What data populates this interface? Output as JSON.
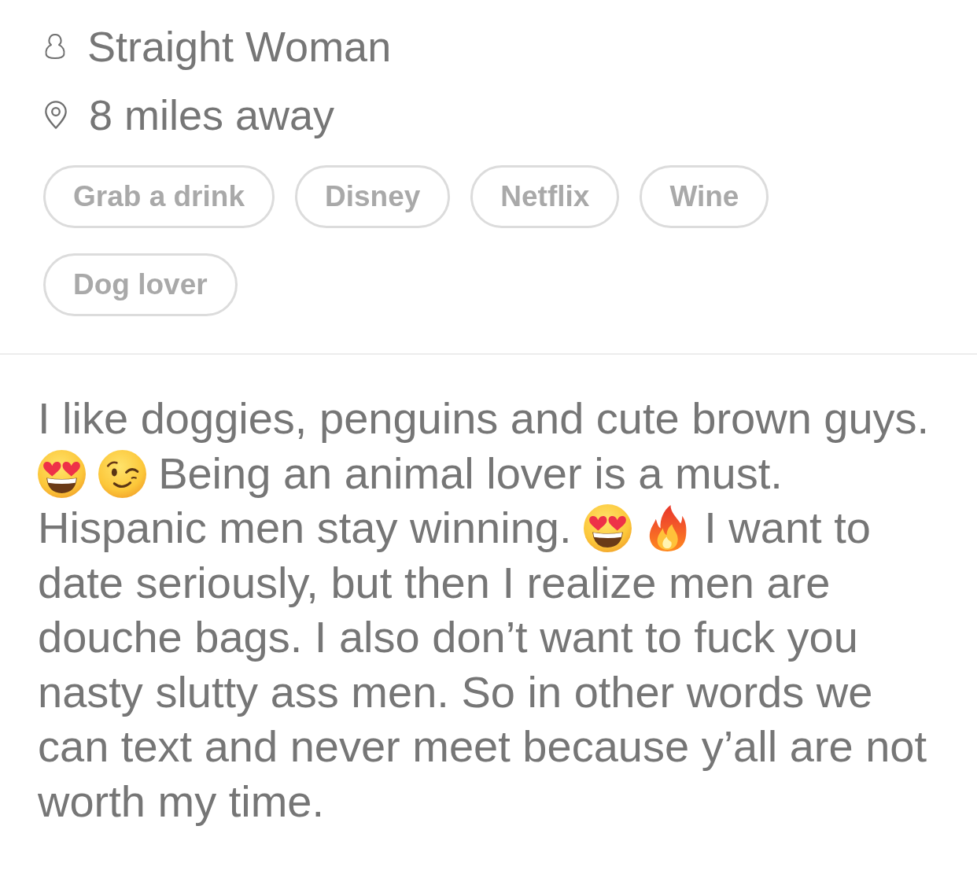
{
  "profile": {
    "orientation": "Straight Woman",
    "distance": "8 miles away"
  },
  "interests": [
    "Grab a drink",
    "Disney",
    "Netflix",
    "Wine",
    "Dog lover"
  ],
  "bio": [
    {
      "kind": "text",
      "text": "I like doggies, penguins and cute brown guys."
    },
    {
      "kind": "hearteyes"
    },
    {
      "kind": "wink"
    },
    {
      "kind": "text",
      "text": "Being an animal lover is a must. Hispanic men stay winning."
    },
    {
      "kind": "hearteyes"
    },
    {
      "kind": "fire"
    },
    {
      "kind": "text",
      "text": "I want to date seriously, but then I realize men are douche bags. I also don’t want to fuck you nasty slutty ass men. So in other words we can text and never meet because y’all are not worth my time."
    }
  ]
}
